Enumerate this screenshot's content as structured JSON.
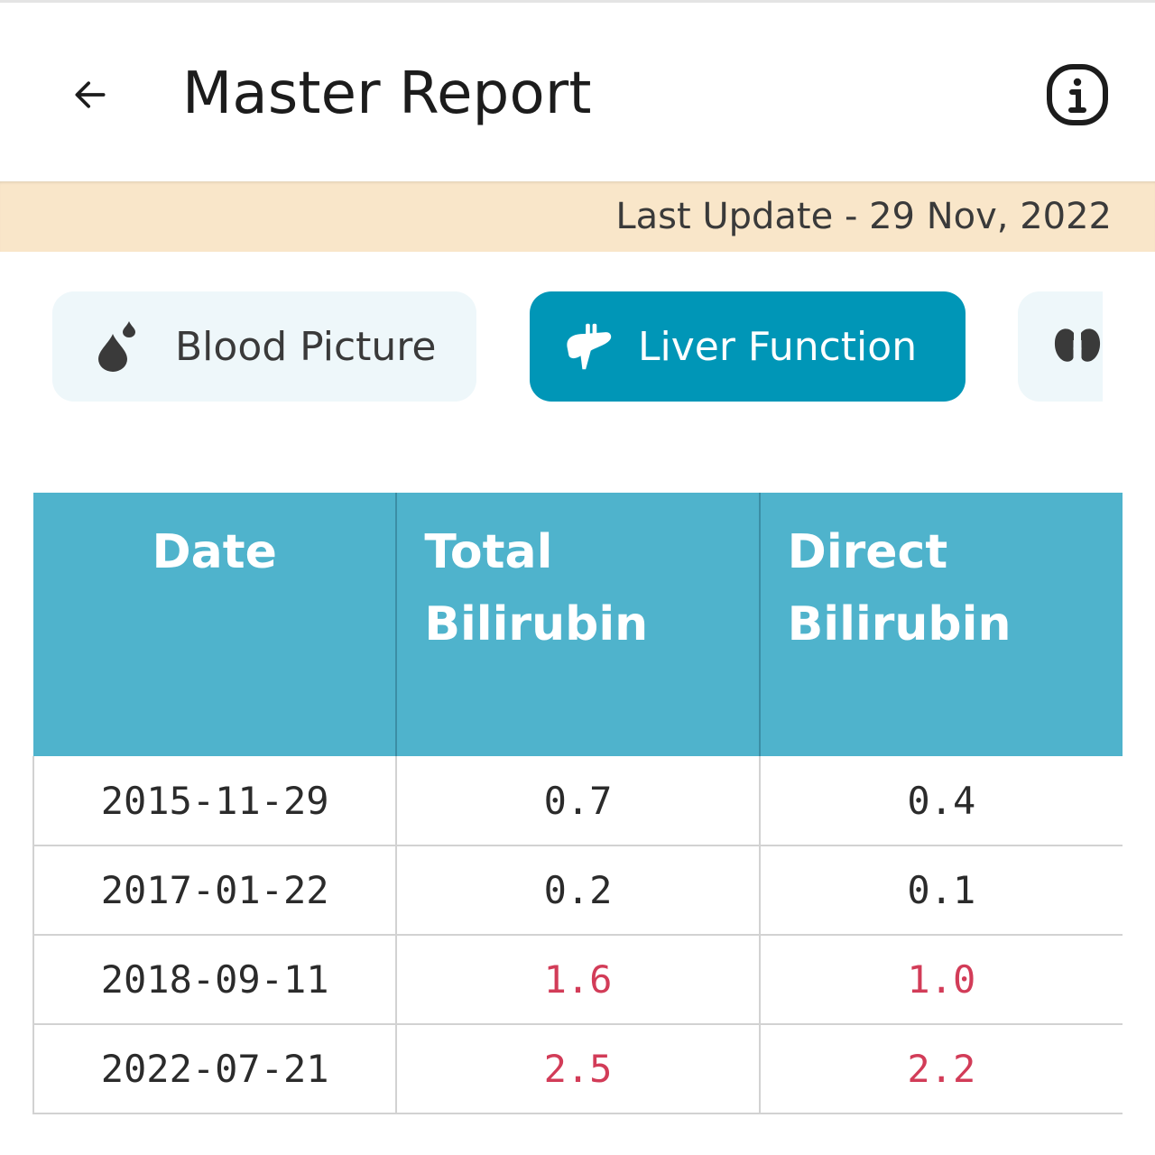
{
  "header": {
    "title": "Master Report",
    "back_icon": "arrow-left-icon",
    "info_icon": "info-icon"
  },
  "banner": {
    "text": "Last Update - 29 Nov, 2022"
  },
  "categories": [
    {
      "label": "Blood Picture",
      "icon": "blood-drop-icon",
      "selected": false
    },
    {
      "label": "Liver Function",
      "icon": "liver-icon",
      "selected": true
    },
    {
      "label": "",
      "icon": "kidney-icon",
      "selected": false
    }
  ],
  "table": {
    "headers": [
      {
        "line1": "Date",
        "line2": ""
      },
      {
        "line1": "Total",
        "line2": "Bilirubin"
      },
      {
        "line1": "Direct",
        "line2": "Bilirubin"
      }
    ],
    "rows": [
      {
        "date": "2015-11-29",
        "total": "0.7",
        "direct": "0.4",
        "total_high": false,
        "direct_high": false
      },
      {
        "date": "2017-01-22",
        "total": "0.2",
        "direct": "0.1",
        "total_high": false,
        "direct_high": false
      },
      {
        "date": "2018-09-11",
        "total": "1.6",
        "direct": "1.0",
        "total_high": true,
        "direct_high": true
      },
      {
        "date": "2022-07-21",
        "total": "2.5",
        "direct": "2.2",
        "total_high": true,
        "direct_high": true
      }
    ]
  },
  "colors": {
    "accent": "#0096b7",
    "table_header": "#4fb3cc",
    "banner": "#f9e6c9",
    "high_value": "#d23c58"
  }
}
